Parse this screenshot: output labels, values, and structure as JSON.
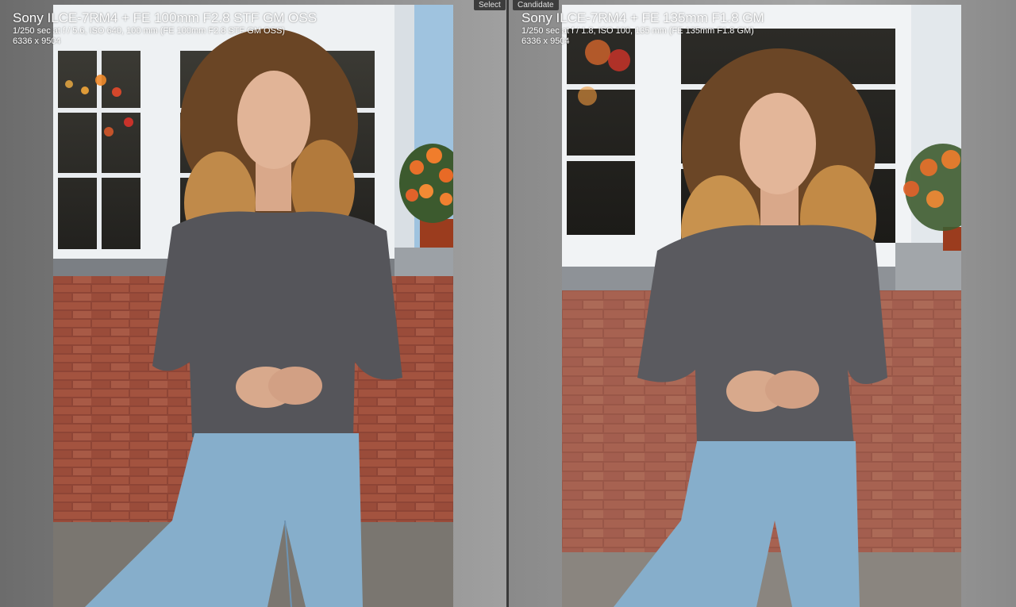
{
  "select_pane": {
    "tag": "Select",
    "camera_lens": "Sony ILCE-7RM4 + FE 100mm F2.8 STF GM OSS",
    "exposure": "1/250 sec at f / 5.6, ISO 640, 100 mm (FE 100mm F2.8 STF GM OSS)",
    "dimensions": "6336 x 9504"
  },
  "candidate_pane": {
    "tag": "Candidate",
    "camera_lens": "Sony ILCE-7RM4 + FE 135mm F1.8 GM",
    "exposure": "1/250 sec at f / 1.8, ISO 100, 135 mm (FE 135mm F1.8 GM)",
    "dimensions": "6336 x 9504"
  }
}
